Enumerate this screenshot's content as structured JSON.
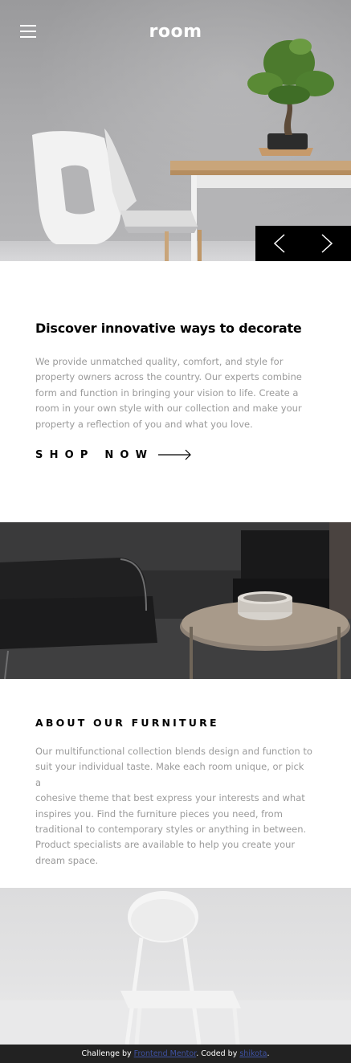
{
  "header": {
    "logo": "room",
    "menu_icon": "hamburger-menu-icon"
  },
  "slider": {
    "prev_icon": "chevron-left-icon",
    "next_icon": "chevron-right-icon"
  },
  "discover": {
    "title": "Discover innovative ways to decorate",
    "body_lines": [
      "We provide unmatched quality, comfort, and style for",
      "property owners across the country. Our experts combine",
      "form and function in bringing your vision to life. Create a",
      "room in your own style with our collection and make your",
      "property a reflection of you and what you love."
    ],
    "cta_label": "SHOP NOW",
    "cta_icon": "arrow-right-icon"
  },
  "about": {
    "title": "ABOUT OUR FURNITURE",
    "body_lines": [
      "Our multifunctional collection blends design and function to",
      "suit your individual taste. Make each room unique, or pick a",
      "cohesive theme that best express your interests and what",
      "inspires you. Find the furniture pieces you need, from",
      "traditional to contemporary styles or anything in between.",
      "Product specialists are available to help you create your",
      "dream space."
    ]
  },
  "attribution": {
    "prefix": "Challenge by ",
    "challenge_link": "Frontend Mentor",
    "middle": ". Coded by ",
    "coder_link": "shikota",
    "suffix": "."
  },
  "colors": {
    "text_primary": "#000000",
    "text_muted": "#9a9a9a",
    "nav_background": "#000000",
    "footer_background": "#222222",
    "link": "#3e52a3"
  }
}
